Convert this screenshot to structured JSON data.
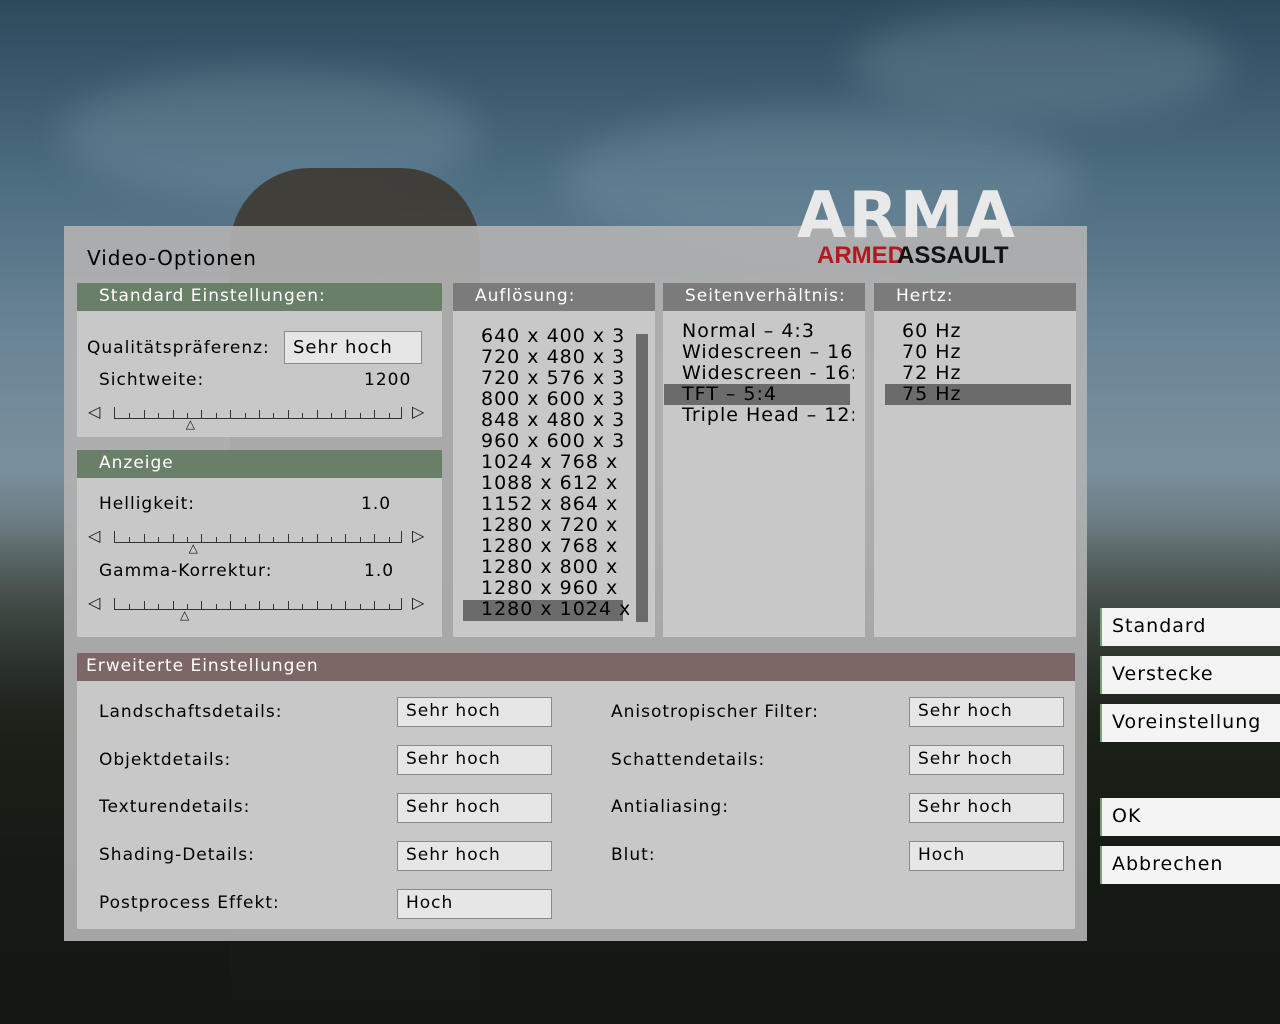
{
  "window": {
    "title": "Video-Optionen"
  },
  "logo": {
    "main": "ARMA",
    "sub_red": "ARMED",
    "sub_dark": "ASSAULT",
    "accent_color": "#b3191d"
  },
  "standard": {
    "header": "Standard Einstellungen:",
    "quality_label": "Qualitätspräferenz:",
    "quality_value": "Sehr hoch",
    "view_label": "Sichtweite:",
    "view_value": "1200",
    "view_level": 0.27
  },
  "display": {
    "header": "Anzeige",
    "brightness_label": "Helligkeit:",
    "brightness_value": "1.0",
    "brightness_level": 0.28,
    "gamma_label": "Gamma-Korrektur:",
    "gamma_value": "1.0",
    "gamma_level": 0.25
  },
  "resolution": {
    "header": "Auflösung:",
    "items": [
      "640 x 400 x 3",
      "720 x 480 x 3",
      "720 x 576 x 3",
      "800 x 600 x 3",
      "848 x 480 x 3",
      "960 x 600 x 3",
      "1024 x 768 x",
      "1088 x 612 x",
      "1152 x 864 x",
      "1280 x 720 x",
      "1280 x 768 x",
      "1280 x 800 x",
      "1280 x 960 x",
      "1280 x 1024 x"
    ],
    "selected_index": 13
  },
  "aspect": {
    "header": "Seitenverhältnis:",
    "items": [
      "Normal – 4:3",
      "Widescreen – 16",
      "Widescreen - 16:",
      "TFT – 5:4",
      "Triple Head – 12:"
    ],
    "selected_index": 3
  },
  "hertz": {
    "header": "Hertz:",
    "items": [
      "60 Hz",
      "70 Hz",
      "72 Hz",
      "75 Hz"
    ],
    "selected_index": 3
  },
  "advanced": {
    "header": "Erweiterte Einstellungen",
    "left": [
      {
        "label": "Landschaftsdetails:",
        "value": "Sehr hoch"
      },
      {
        "label": "Objektdetails:",
        "value": "Sehr hoch"
      },
      {
        "label": "Texturendetails:",
        "value": "Sehr hoch"
      },
      {
        "label": "Shading-Details:",
        "value": "Sehr hoch"
      },
      {
        "label": "Postprocess Effekt:",
        "value": "Hoch"
      }
    ],
    "right": [
      {
        "label": "Anisotropischer Filter:",
        "value": "Sehr hoch"
      },
      {
        "label": "Schattendetails:",
        "value": "Sehr hoch"
      },
      {
        "label": "Antialiasing:",
        "value": "Sehr hoch"
      },
      {
        "label": "Blut:",
        "value": "Hoch"
      }
    ]
  },
  "side_buttons": {
    "standard": "Standard",
    "hide": "Verstecke",
    "preset": "Voreinstellung",
    "ok": "OK",
    "cancel": "Abbrechen"
  },
  "colors": {
    "green_header": "#6a7f68",
    "gray_header": "#7b7b7b",
    "brown_header": "#7d6666",
    "selection": "#6b6b6b"
  }
}
